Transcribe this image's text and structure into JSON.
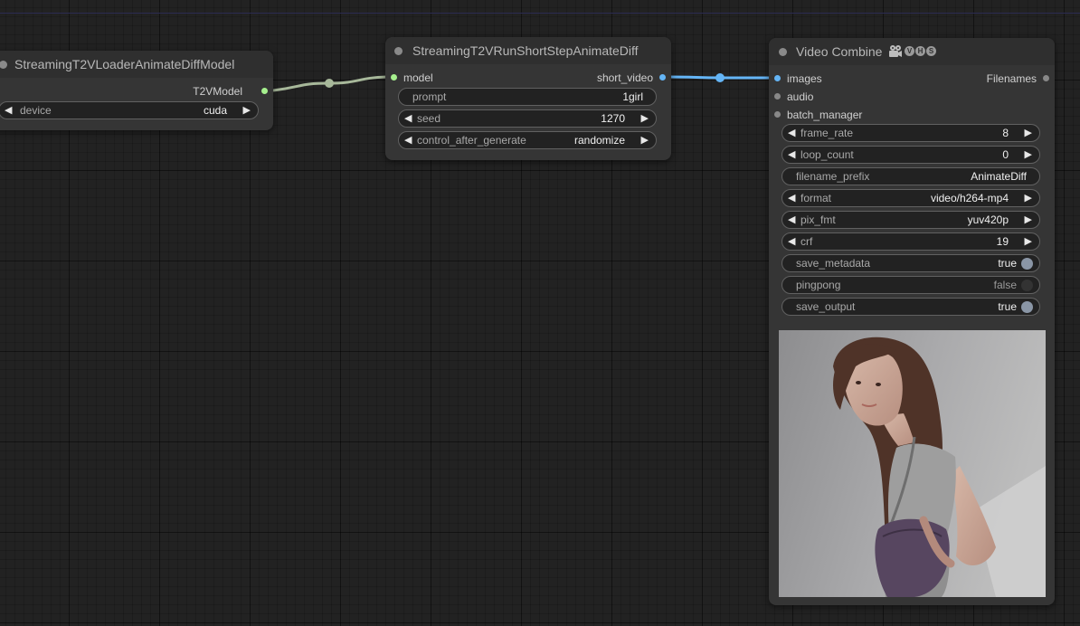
{
  "colors": {
    "canvas_bg": "#222222",
    "node_bg": "#353535",
    "node_header_bg": "#2f2f2f",
    "widget_bg": "#222222",
    "model_link": "#a7b89a",
    "video_link": "#64b5f6",
    "model_slot": "#a6f08e",
    "image_slot": "#64b5f6",
    "inactive_slot": "#888888"
  },
  "icons": {
    "film": "film-icon",
    "left_arrow": "◀",
    "right_arrow": "▶"
  },
  "loader_node": {
    "title": "StreamingT2VLoaderAnimateDiffModel",
    "output_label": "T2VModel",
    "device": {
      "label": "device",
      "value": "cuda"
    }
  },
  "run_node": {
    "title": "StreamingT2VRunShortStepAnimateDiff",
    "input_label": "model",
    "output_label": "short_video",
    "prompt": {
      "label": "prompt",
      "value": "1girl"
    },
    "seed": {
      "label": "seed",
      "value": "1270"
    },
    "control": {
      "label": "control_after_generate",
      "value": "randomize"
    }
  },
  "video_node": {
    "title": "Video Combine",
    "badge_letters": [
      "V",
      "H",
      "S"
    ],
    "inputs": {
      "images": "images",
      "audio": "audio",
      "batch_manager": "batch_manager"
    },
    "output_label": "Filenames",
    "frame_rate": {
      "label": "frame_rate",
      "value": "8"
    },
    "loop_count": {
      "label": "loop_count",
      "value": "0"
    },
    "filename_prefix": {
      "label": "filename_prefix",
      "value": "AnimateDiff"
    },
    "format": {
      "label": "format",
      "value": "video/h264-mp4"
    },
    "pix_fmt": {
      "label": "pix_fmt",
      "value": "yuv420p"
    },
    "crf": {
      "label": "crf",
      "value": "19"
    },
    "save_metadata": {
      "label": "save_metadata",
      "value": "true"
    },
    "pingpong": {
      "label": "pingpong",
      "value": "false"
    },
    "save_output": {
      "label": "save_output",
      "value": "true"
    }
  }
}
